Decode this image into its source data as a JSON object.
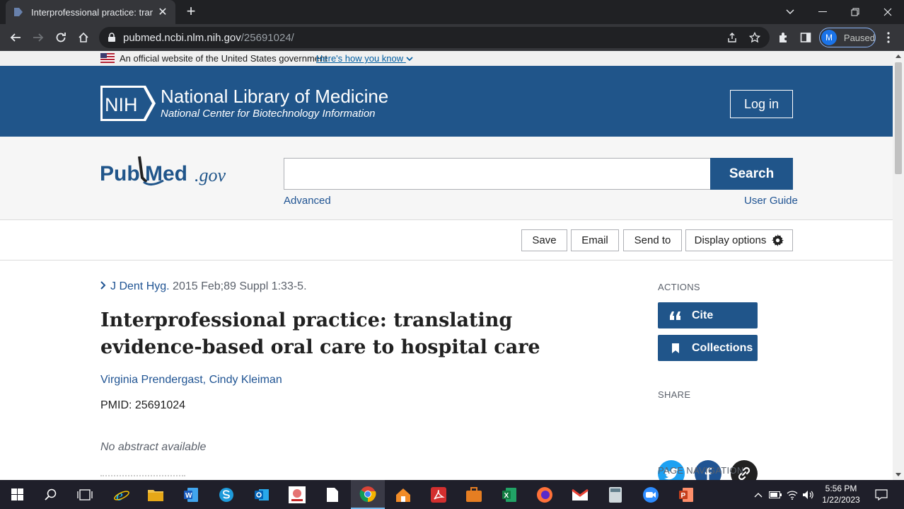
{
  "browser": {
    "tab_title": "Interprofessional practice: transla",
    "url_host": "pubmed.ncbi.nlm.nih.gov",
    "url_path": "/25691024/",
    "profile_initial": "M",
    "profile_status": "Paused"
  },
  "gov_banner": {
    "text": "An official website of the United States government",
    "link": "Here's how you know"
  },
  "nih_header": {
    "logo_text": "NIH",
    "title": "National Library of Medicine",
    "subtitle": "National Center for Biotechnology Information",
    "login": "Log in"
  },
  "search": {
    "logo_pub": "Pub",
    "logo_med": "Med",
    "logo_gov": ".gov",
    "query": "",
    "button": "Search",
    "advanced": "Advanced",
    "user_guide": "User Guide"
  },
  "actions_bar": {
    "save": "Save",
    "email": "Email",
    "send_to": "Send to",
    "display_options": "Display options"
  },
  "article": {
    "journal": "J Dent Hyg.",
    "citation": " 2015 Feb;89 Suppl 1:33-5.",
    "title": "Interprofessional practice: translating evidence-based oral care to hospital care",
    "authors": "Virginia Prendergast, Cindy Kleiman",
    "pmid": "PMID: 25691024",
    "abstract": "No abstract available"
  },
  "sidebar": {
    "actions_heading": "ACTIONS",
    "cite": "Cite",
    "collections": "Collections",
    "share_heading": "SHARE",
    "page_nav_heading": "PAGE NAVIGATION"
  },
  "taskbar": {
    "time": "5:56 PM",
    "date": "1/22/2023"
  },
  "colors": {
    "nih_blue": "#20558a",
    "link_blue": "#205493",
    "twitter": "#1da1f2",
    "facebook": "#205493",
    "permalink": "#212121"
  }
}
